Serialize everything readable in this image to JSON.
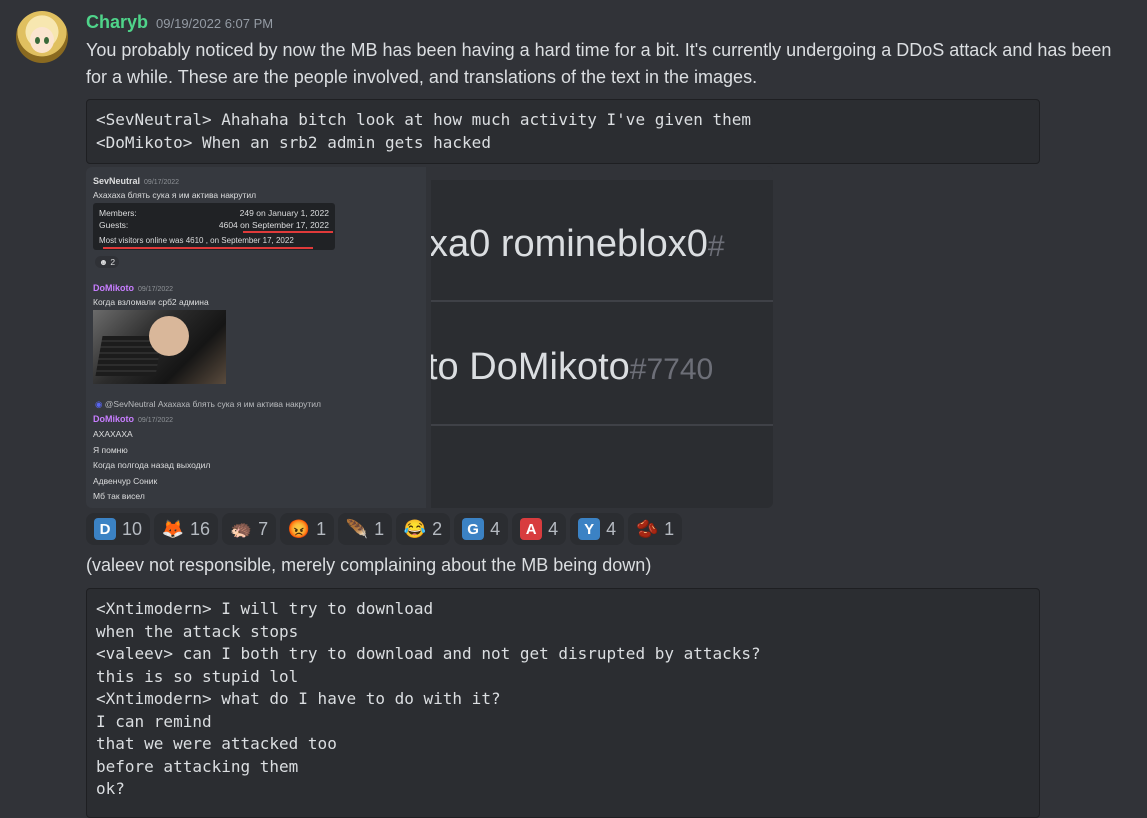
{
  "message": {
    "username": "Charyb",
    "timestamp": "09/19/2022 6:07 PM",
    "text": "You probably noticed by now the MB has been having a hard time for a bit. It's currently undergoing a DDoS attack and has been for a while. These are the people involved, and translations of the text in the images.",
    "code1": "<SevNeutral> Ahahaha bitch look at how much activity I've given them\n<DoMikoto> When an srb2 admin gets hacked",
    "followup": "(valeev not responsible, merely complaining about the MB being down)",
    "code2": "<Xntimodern> I will try to download\nwhen the attack stops\n<valeev> can I both try to download and not get disrupted by attacks?\nthis is so stupid lol\n<Xntimodern> what do I have to do with it?\nI can remind\nthat we were attacked too\nbefore attacking them\nok?"
  },
  "image1": {
    "msg1": {
      "name": "SevNeutral",
      "date": "09/17/2022",
      "text": "Ахахаха блять сука я им актива накрутил"
    },
    "stats": {
      "members_label": "Members:",
      "members_value": "249 on January 1, 2022",
      "guests_label": "Guests:",
      "guests_value": "4604 on September 17, 2022",
      "most": "Most visitors online was 4610 , on September 17, 2022"
    },
    "reaction_count": "2",
    "msg2": {
      "name": "DoMikoto",
      "date": "09/17/2022",
      "text": "Когда взломали срб2 админа"
    },
    "reply": {
      "ref": "@SevNeutral",
      "text": "Ахахаха блять сука я им актива накрутил"
    },
    "msg3": {
      "name": "DoMikoto",
      "date": "09/17/2022"
    },
    "lines": [
      "АХАХАХА",
      "Я помню",
      "Когда полгода назад выходил",
      "Адвенчур Соник",
      "Мб так висел"
    ]
  },
  "image2": {
    "row1_prefix": "xa0",
    "row1_name": "romineblox0",
    "row1_disc": "#",
    "row2_prefix": "to",
    "row2_name": "DoMikoto",
    "row2_disc": "#7740"
  },
  "reactions": [
    {
      "icon": "letter-d-icon",
      "glyph": "D",
      "color": "#3b82c4",
      "count": "10"
    },
    {
      "icon": "fox-icon",
      "glyph": "🦊",
      "color": "",
      "count": "16"
    },
    {
      "icon": "sonic-icon",
      "glyph": "🦔",
      "color": "",
      "count": "7"
    },
    {
      "icon": "angry-red-icon",
      "glyph": "😡",
      "color": "",
      "count": "1"
    },
    {
      "icon": "feather-icon",
      "glyph": "🪶",
      "color": "",
      "count": "1"
    },
    {
      "icon": "laughing-icon",
      "glyph": "😂",
      "color": "",
      "count": "2"
    },
    {
      "icon": "letter-g-icon",
      "glyph": "G",
      "color": "#3b82c4",
      "count": "4"
    },
    {
      "icon": "letter-a-icon",
      "glyph": "A",
      "color": "#d83c3e",
      "count": "4"
    },
    {
      "icon": "letter-y-icon",
      "glyph": "Y",
      "color": "#3b82c4",
      "count": "4"
    },
    {
      "icon": "bean-icon",
      "glyph": "🫘",
      "color": "",
      "count": "1"
    }
  ]
}
